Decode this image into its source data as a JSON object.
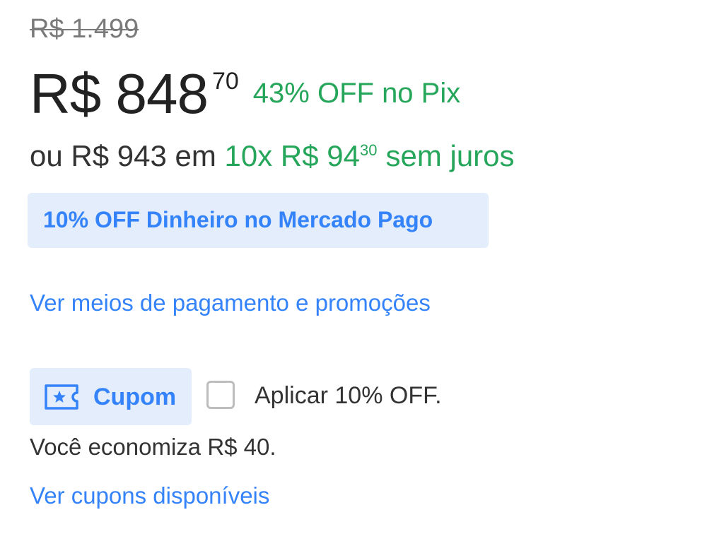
{
  "price": {
    "old_price": "R$ 1.499",
    "current_main": "R$ 848",
    "current_cents": "70",
    "pix_discount": "43% OFF no Pix"
  },
  "installments": {
    "prefix": "ou R$ 943 em ",
    "count_value": "10x R$ 94",
    "cents": "30",
    "suffix": "sem juros"
  },
  "promo": {
    "label": "10% OFF Dinheiro no Mercado Pago"
  },
  "payment_link": "Ver meios de pagamento e promoções",
  "coupon": {
    "button_label": "Cupom",
    "icon": "coupon-ticket-star-icon",
    "apply_label": "Aplicar 10% OFF.",
    "checked": false,
    "savings_text": "Você economiza R$ 40.",
    "available_link": "Ver cupons disponíveis"
  },
  "colors": {
    "accent_blue": "#3483fa",
    "promo_bg": "#e3edfb",
    "green": "#26a65b"
  }
}
